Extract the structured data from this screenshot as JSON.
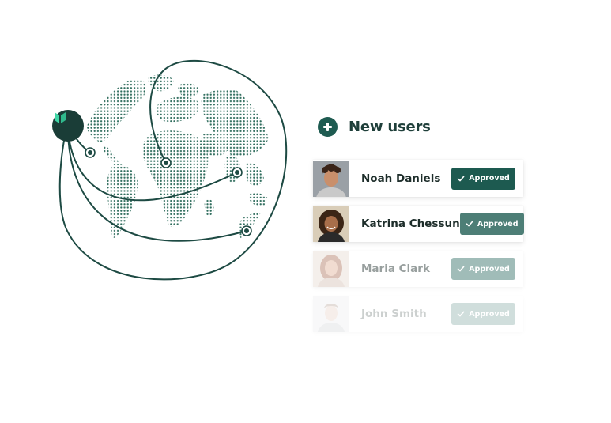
{
  "panel": {
    "title": "New users"
  },
  "users": [
    {
      "name": "Noah Daniels",
      "status": "Approved",
      "avatar_icon": "avatar-photo-man-curly-hair"
    },
    {
      "name": "Katrina Chessun",
      "status": "Approved",
      "avatar_icon": "avatar-photo-woman-curly-hair"
    },
    {
      "name": "Maria Clark",
      "status": "Approved",
      "avatar_icon": "avatar-photo-woman-faded"
    },
    {
      "name": "John Smith",
      "status": "Approved",
      "avatar_icon": "avatar-photo-man-faded"
    }
  ],
  "colors": {
    "brand_dark": "#1a3d37",
    "brand_accent": "#1e5b51",
    "globe_dots": "#2f6d5d",
    "logo_leaf": "#3fd6a6"
  }
}
